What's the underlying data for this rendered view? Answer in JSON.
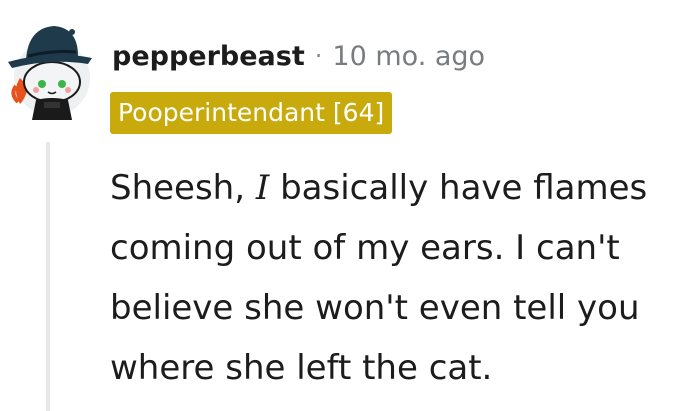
{
  "comment": {
    "author": {
      "username": "pepperbeast",
      "separator": "·",
      "timestamp": "10 mo. ago",
      "avatar_icon": "snoo-avatar-icon"
    },
    "flair": {
      "text": "Pooperintendant [64]",
      "background": "#c9aa0c",
      "color": "#ffffff"
    },
    "body": {
      "line1_before": "Sheesh, ",
      "line1_emphasis": "I",
      "line1_after": " basically have flames",
      "line2": "coming out of my ears. I can't",
      "line3": "believe she won't even tell you",
      "line4": "where she left the cat."
    }
  }
}
